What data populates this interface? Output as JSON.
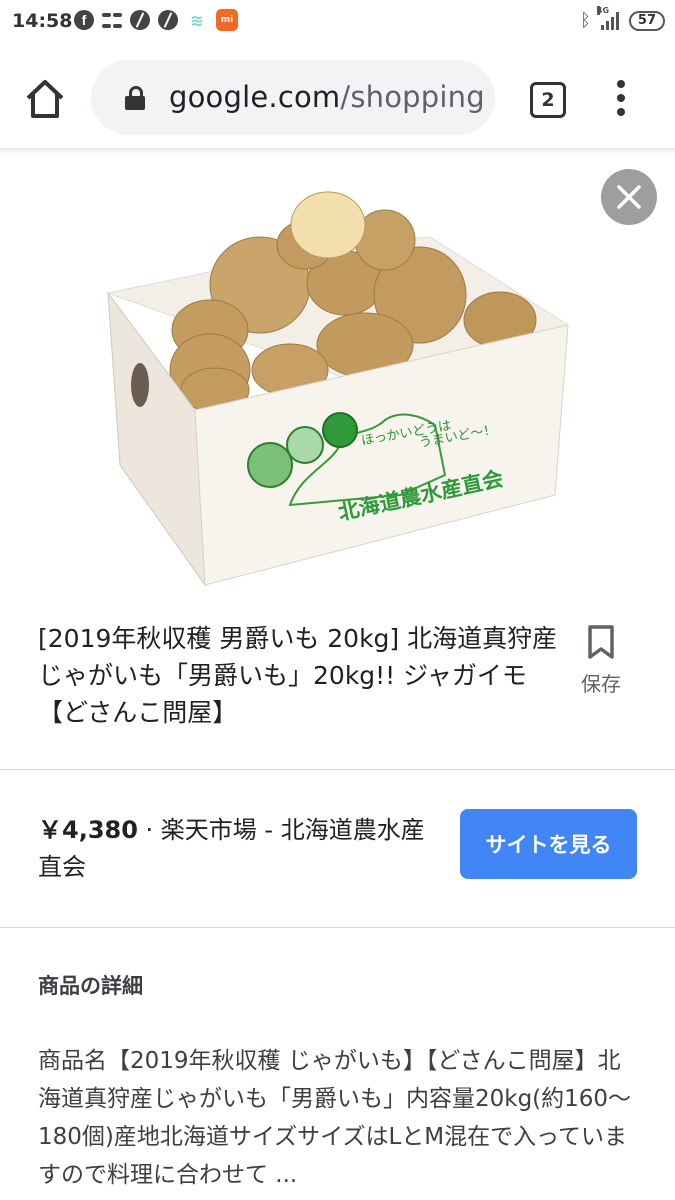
{
  "status_bar": {
    "time": "14:58",
    "network": "4G",
    "battery": "57",
    "icons": [
      "facebook-icon",
      "grid-app-icon",
      "ball-icon",
      "ball-icon",
      "app-icon",
      "mi-icon",
      "bluetooth-icon",
      "signal-icon",
      "battery-icon"
    ]
  },
  "browser": {
    "url_domain": "google.com",
    "url_path": "/shopping",
    "tab_count": "2"
  },
  "product": {
    "image_box_text_1": "ほっかいどうは",
    "image_box_text_2": "うまいど〜！",
    "image_box_brand": "北海道農水産直会",
    "title": "[2019年秋収穫 男爵いも 20kg] 北海道真狩産じゃがいも「男爵いも」20kg!! ジャガイモ【どさんこ問屋】",
    "save_label": "保存",
    "price": "￥4,380",
    "seller": " · 楽天市場 - 北海道農水産直会",
    "visit_button": "サイトを見る",
    "details_heading": "商品の詳細",
    "details_text": "商品名【2019年秋収穫 じゃがいも】【どさんこ問屋】北海道真狩産じゃがいも「男爵いも」内容量20kg(約160〜180個)産地北海道サイズサイズはLとM混在で入っていますので料理に合わせて ..."
  },
  "colors": {
    "accent_blue": "#4285f4",
    "url_bar_bg": "#f1f3f4",
    "close_button": "#9e9e9e",
    "box_print_green": "#3a9a3a"
  }
}
